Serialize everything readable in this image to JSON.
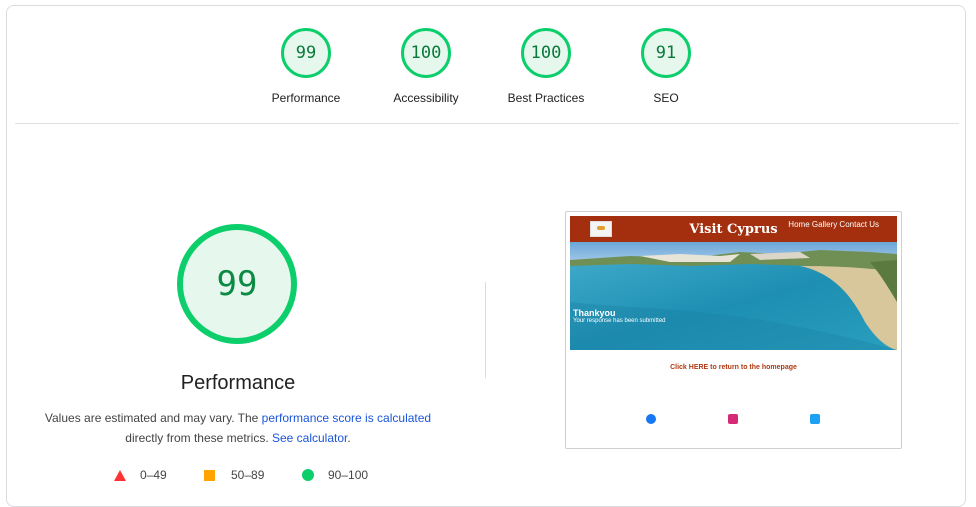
{
  "categories": [
    {
      "score": "99",
      "label": "Performance"
    },
    {
      "score": "100",
      "label": "Accessibility"
    },
    {
      "score": "100",
      "label": "Best Practices"
    },
    {
      "score": "91",
      "label": "SEO"
    }
  ],
  "main": {
    "score": "99",
    "title": "Performance",
    "desc_1": "Values are estimated and may vary. The ",
    "desc_link_1": "performance score is calculated",
    "desc_2": "directly from these metrics. ",
    "desc_link_2": "See calculator",
    "desc_3": "."
  },
  "legend": {
    "fail": "0–49",
    "average": "50–89",
    "pass": "90–100"
  },
  "screenshot": {
    "site_title": "Visit Cyprus",
    "nav": "Home Gallery Contact Us",
    "hero_title": "Thankyou",
    "hero_sub": "Your response has been submitted",
    "cta": "Click HERE to return to the homepage"
  },
  "colors": {
    "pass": "#0cce6b",
    "average": "#ffa400",
    "fail": "#ff3333",
    "link": "#1a56db",
    "site_header": "#a42f0e"
  },
  "icons": {
    "social": [
      "facebook-icon",
      "instagram-icon",
      "twitter-icon"
    ]
  }
}
